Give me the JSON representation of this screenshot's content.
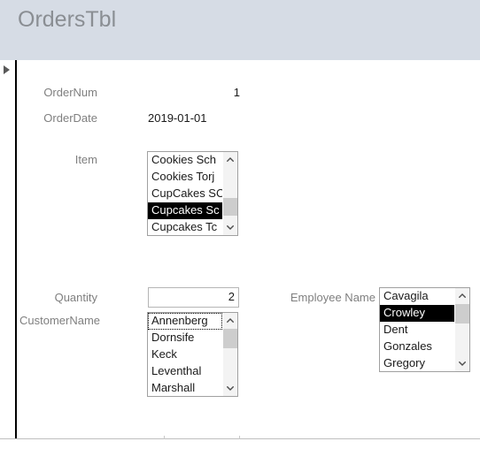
{
  "window": {
    "title": "OrdersTbl"
  },
  "record_selector": {
    "icon": "play-triangle-icon"
  },
  "fields": {
    "order_num": {
      "label": "OrderNum",
      "value": "1"
    },
    "order_date": {
      "label": "OrderDate",
      "value": "2019-01-01"
    },
    "item": {
      "label": "Item",
      "options": [
        "Cookies Sch",
        "Cookies Torj",
        "CupCakes SC",
        "Cupcakes Sc",
        "Cupcakes Tc"
      ],
      "selected_index": 3
    },
    "quantity": {
      "label": "Quantity",
      "value": "2"
    },
    "customer_name": {
      "label": "CustomerName",
      "options": [
        "Annenberg",
        "Dornsife",
        "Keck",
        "Leventhal",
        "Marshall"
      ],
      "focused_index": 0,
      "selected_index": -1
    },
    "employee_name": {
      "label": "Employee Name",
      "options": [
        "Cavagila",
        "Crowley",
        "Dent",
        "Gonzales",
        "Gregory"
      ],
      "selected_index": 1
    }
  },
  "colors": {
    "header_band": "#d6dce5",
    "title_text": "#8a8e93",
    "label_text": "#7f7f7f",
    "selection_bg": "#000000",
    "selection_fg": "#ffffff",
    "scrollbar_track": "#f3f3f3",
    "scrollbar_thumb": "#cdcdcd"
  }
}
